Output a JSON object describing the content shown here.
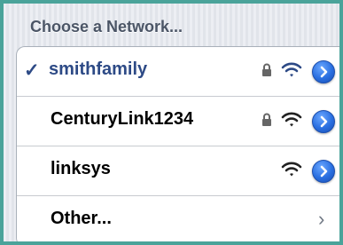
{
  "header": {
    "title": "Choose a Network..."
  },
  "networks": [
    {
      "check": "✓",
      "name": "smithfamily",
      "icons": [
        "lock-icon",
        "wifi-icon",
        "info-icon"
      ]
    },
    {
      "name": "CenturyLink1234",
      "icons": [
        "lock-icon",
        "wifi-icon",
        "info-icon"
      ]
    },
    {
      "name": "linksys",
      "icons": [
        "wifi-icon",
        "info-icon"
      ]
    }
  ],
  "other": {
    "label": "Other...",
    "chevron": "›"
  },
  "colors": {
    "selected_text": "#2d4a86",
    "info_blue": "#2a6fe0",
    "header_text": "#4b5566"
  }
}
